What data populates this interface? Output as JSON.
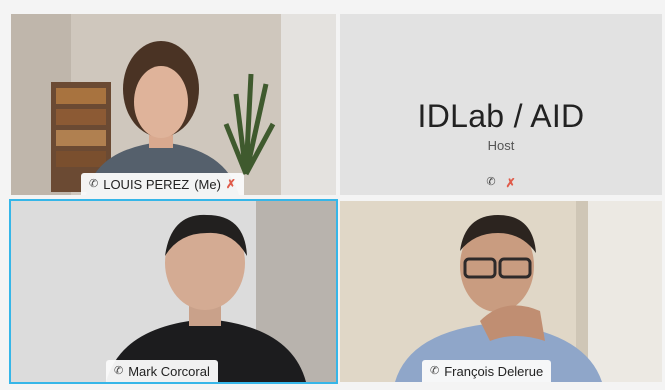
{
  "participants": [
    {
      "name": "LOUIS PEREZ",
      "suffix": "(Me)",
      "mic_icon": "mic-icon",
      "status_icon": "muted-mic-icon"
    },
    {
      "name": "Mark Corcoral",
      "mic_icon": "mic-icon"
    },
    {
      "name": "François Delerue",
      "mic_icon": "mic-icon"
    }
  ],
  "host_tile": {
    "title": "IDLab / AID",
    "subtitle": "Host",
    "icons": [
      "mic-icon",
      "muted-mic-icon"
    ]
  },
  "colors": {
    "active_speaker_border": "#36b6e8",
    "muted_icon": "#e05b4a"
  }
}
